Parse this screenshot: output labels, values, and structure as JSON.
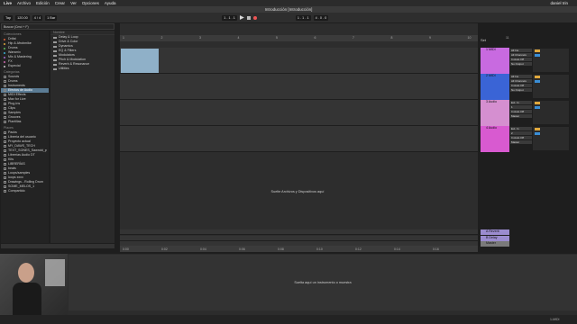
{
  "menubar": {
    "app": "Live",
    "items": [
      "Archivo",
      "Edición",
      "Crear",
      "Ver",
      "Opciones",
      "Ayuda"
    ],
    "user": "daniel trin"
  },
  "window_title": "Introducción [Introducción]",
  "transport": {
    "tap": "Tap",
    "bpm": "120.00",
    "sig": "4 / 4",
    "position": "1 . 1 . 1",
    "bar": "1 Bar",
    "loop_pos": "1 . 1 . 1",
    "loop_len": "4 . 0 . 0"
  },
  "browser": {
    "search": "Buscar (Cmd + F)",
    "collections_label": "Colecciones",
    "collections": [
      {
        "label": "Drifat",
        "color": "#e0623a"
      },
      {
        "label": "Hip & Afrobmike",
        "color": "#e0a83d"
      },
      {
        "label": "Drums",
        "color": "#5ebd5a"
      },
      {
        "label": "Warsmix",
        "color": "#3ab0d6"
      },
      {
        "label": "Mix & Mastering",
        "color": "#a86ad0"
      },
      {
        "label": "FX",
        "color": "#d06ab1"
      },
      {
        "label": "Especial",
        "color": "#cfcfcf"
      }
    ],
    "categories_label": "Categorías",
    "categories": [
      "Sounds",
      "Drums",
      "Instruments",
      "Efectos de Audio",
      "MIDI Effects",
      "Max for Live",
      "Plug-Ins",
      "Clips",
      "Samples",
      "Grooves",
      "Plantillas"
    ],
    "places_label": "Places",
    "places": [
      "Packs",
      "Librería del usuario",
      "Proyecto actual",
      "MY_DAWS_TECH",
      "TEXT_SONES_Sawndd_p",
      "Librerías Audio DT",
      "Kits",
      "LIBRERÍAS",
      "beats",
      "Loops/samples",
      "loops xxxx",
      "Drawings - Rolling Drum",
      "SOME_MELOS_1",
      "Compartido"
    ],
    "content_header": "Nombre",
    "content_items": [
      "Delay & Loop",
      "Drive & Color",
      "Dynamics",
      "EQ & Filters",
      "Modulators",
      "Pitch & Modulation",
      "Reverb & Resonance",
      "Utilities"
    ]
  },
  "ruler": [
    "1",
    "2",
    "3",
    "4",
    "5",
    "6",
    "7",
    "8",
    "9",
    "10",
    "11"
  ],
  "timeline": [
    "0:00",
    "0:02",
    "0:04",
    "0:06",
    "0:08",
    "0:10",
    "0:12",
    "0:14",
    "0:16"
  ],
  "tracks": [
    {
      "label": "1 MIDI",
      "color": "#c86ae0",
      "io": [
        "All Ins",
        "All Channels",
        "In Auto Off",
        "No Output"
      ]
    },
    {
      "label": "2 MIDI",
      "color": "#3a64d6",
      "io": [
        "All Ins",
        "All Channels",
        "In Auto Off",
        "No Output"
      ]
    },
    {
      "label": "3 Audio",
      "color": "#d58fd0",
      "io": [
        "Ext. In",
        "1",
        "In Auto Off",
        "Master"
      ]
    },
    {
      "label": "4 Audio",
      "color": "#d85ad0",
      "io": [
        "Ext. In",
        "2",
        "In Auto Off",
        "Master"
      ]
    }
  ],
  "returns": [
    {
      "label": "A Reverb"
    },
    {
      "label": "B Delay"
    },
    {
      "label": "Master"
    }
  ],
  "set_label": "Set",
  "drop_message": "Suelte Archivos y Dispositivos aquí",
  "device_drop": "Suelta aquí un instrumento o muestra",
  "status": "1-MIDI"
}
